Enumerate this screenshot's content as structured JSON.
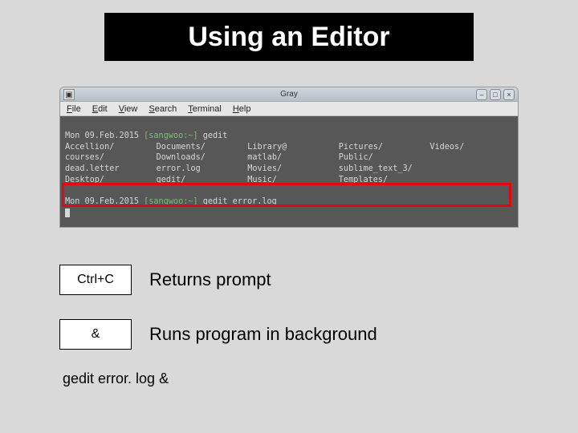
{
  "title": "Using an Editor",
  "window": {
    "title": "Gray",
    "menus": {
      "file": "File",
      "edit": "Edit",
      "view": "View",
      "search": "Search",
      "terminal": "Terminal",
      "help": "Help"
    },
    "buttons": {
      "min": "–",
      "max": "□",
      "close": "×"
    }
  },
  "terminal": {
    "line1_date": "Mon 09.Feb.2015",
    "line1_userpath": "[sangwoo:~]",
    "line1_cmd": "gedit",
    "ls": {
      "r0": [
        "Accellion/",
        "Documents/",
        "Library@",
        "Pictures/",
        "Videos/"
      ],
      "r1": [
        "courses/",
        "Downloads/",
        "matlab/",
        "Public/",
        ""
      ],
      "r2": [
        "dead.letter",
        "error.log",
        "Movies/",
        "sublime_text_3/",
        ""
      ],
      "r3": [
        "Desktop/",
        "gedit/",
        "Music/",
        "Templates/",
        ""
      ]
    },
    "line2_date": "Mon 09.Feb.2015",
    "line2_userpath": "[sangwoo:~]",
    "line2_cmd": "gedit error.log"
  },
  "keys": {
    "ctrl_c": {
      "label": "Ctrl+C",
      "desc": "Returns prompt"
    },
    "amp": {
      "label": "&",
      "desc": "Runs program in background"
    }
  },
  "example": "gedit error. log &"
}
